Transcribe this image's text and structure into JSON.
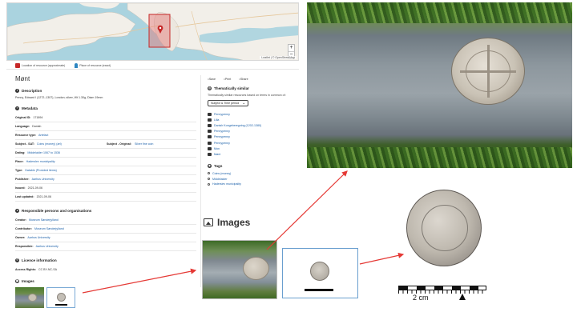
{
  "map": {
    "zoom_in": "+",
    "zoom_out": "−",
    "attribution": "Leaflet | © OpenStreetMap",
    "legend": {
      "area_label": "Location of resource (approximate)",
      "point_label": "Place of resource (exact)"
    }
  },
  "record": {
    "title": "Mønt",
    "description_heading": "Description",
    "description": "Penny, Edward I (1272–1307), London; silver, Wt 1.30g, Diam 19mm",
    "metadata_heading": "Metadata",
    "fields": [
      {
        "key": "Original ID:",
        "value": "171894"
      },
      {
        "key": "Language:",
        "value": "Danish"
      },
      {
        "key": "Resource type:",
        "value": "Artefact"
      },
      {
        "key": "Subject - SAT:",
        "value": "Coins (money) (art)",
        "key2": "Subject - Original:",
        "value2": "Silver fine coin"
      },
      {
        "key": "Dating:",
        "value": "Middelalder 1067 to 1536"
      },
      {
        "key": "Place:",
        "value": "Haderslev municipality"
      },
      {
        "key": "Type:",
        "value": "Datable (Provided items)"
      },
      {
        "key": "Publisher:",
        "value": "Aarhus University"
      },
      {
        "key": "Issued:",
        "value": "2021-09-06"
      },
      {
        "key": "Last updated:",
        "value": "2021-09-06"
      }
    ],
    "persons_heading": "Responsible persons and organisations",
    "persons": [
      {
        "key": "Creator:",
        "value": "Museum Sønderjylland"
      },
      {
        "key": "Contributor:",
        "value": "Museum Sønderjylland"
      },
      {
        "key": "Owner:",
        "value": "Aarhus University"
      },
      {
        "key": "Responsible:",
        "value": "Aarhus University"
      }
    ],
    "licence_heading": "Licence information",
    "licence": {
      "key": "Access Rights:",
      "value": "CC BY-NC-SA"
    },
    "images_heading": "Images"
  },
  "sidebar": {
    "actions": [
      "Save",
      "Print",
      "Share"
    ],
    "similar_heading": "Thematically similar",
    "similar_note": "Thematically similar resources based on terms in common of:",
    "select_value": "Subject & Time period",
    "related": [
      "Pennypenny",
      "Lilla",
      "Danish Kongeberegning (1202-1380)",
      "Pennypenny",
      "Pennypenny",
      "Pennypenny",
      "Mon",
      "Mønt"
    ],
    "tags_heading": "Tags",
    "tags": [
      "Coins (money)",
      "Middelalder",
      "Haderslev municipality"
    ]
  },
  "enlarged": {
    "images_heading": "Images"
  },
  "scale_bar": {
    "label": "2 cm"
  },
  "colors": {
    "link": "#1a5fa8",
    "map_marker": "#c62828",
    "arrow": "#e53935"
  }
}
